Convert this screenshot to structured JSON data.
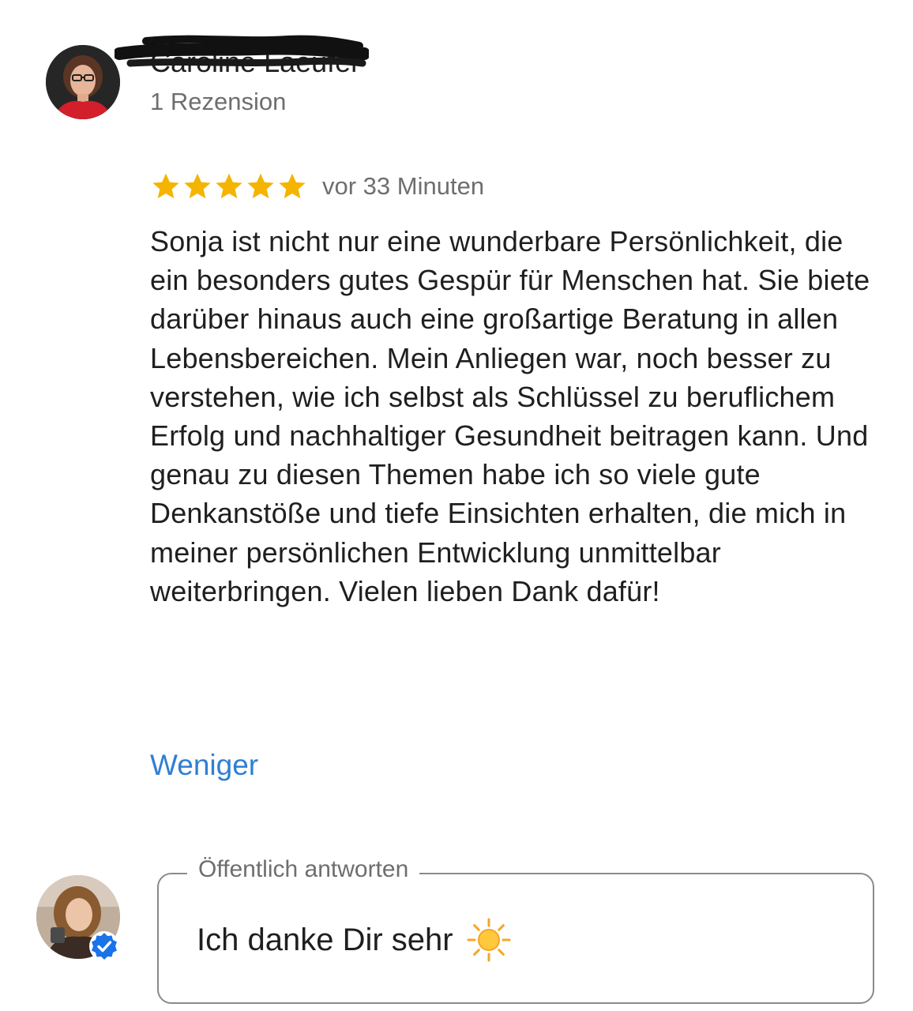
{
  "reviewer": {
    "name": "Caroline Laeufer",
    "review_count": "1 Rezension"
  },
  "review": {
    "rating": 5,
    "rating_max": 5,
    "time": "vor 33 Minuten",
    "text": "Sonja ist nicht nur eine wunderbare Persönlichkeit, die ein besonders gutes Gespür für Menschen hat. Sie biete darüber hinaus auch eine großartige Beratung in allen Lebensbereichen. Mein Anliegen war, noch besser zu verstehen, wie ich selbst als Schlüssel zu beruflichem Erfolg und nachhaltiger Gesundheit beitragen kann. Und genau zu diesen Themen habe ich so viele gute Denkanstöße und tiefe Einsichten erhalten, die mich in meiner persönlichen Entwicklung unmittelbar weiterbringen. Vielen lieben Dank dafür!",
    "less_label": "Weniger"
  },
  "reply": {
    "label": "Öffentlich antworten",
    "value": "Ich danke Dir sehr"
  },
  "icons": {
    "star": "star-icon",
    "reply_emoji": "sun-icon",
    "owner_badge": "verified-check-icon"
  },
  "colors": {
    "star": "#F4B400",
    "link": "#2F7FD1",
    "secondary_text": "#6E6E6E",
    "verified": "#1A73E8"
  }
}
